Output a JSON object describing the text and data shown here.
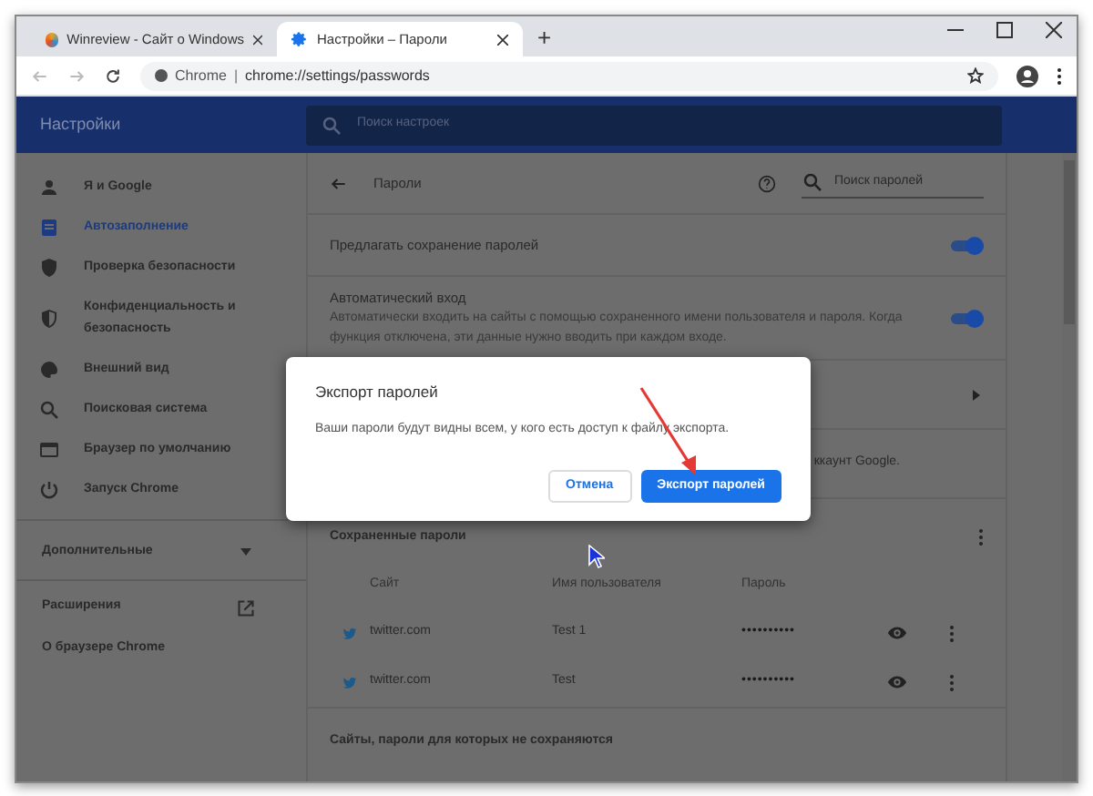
{
  "tabs": [
    {
      "title": "Winreview - Сайт о Windows",
      "kind": "site",
      "selected": false
    },
    {
      "title": "Настройки – Пароли",
      "kind": "settings",
      "selected": true
    }
  ],
  "new_tab": "+",
  "address": {
    "prefix": "Chrome",
    "separator": "|",
    "url": "chrome://settings/passwords"
  },
  "header": {
    "title": "Настройки",
    "search_placeholder": "Поиск настроек"
  },
  "sidebar": {
    "items": [
      {
        "label": "Я и Google",
        "kind": "person",
        "selected": false
      },
      {
        "label": "Автозаполнение",
        "kind": "clipboard",
        "selected": true
      },
      {
        "label": "Проверка безопасности",
        "kind": "shield",
        "selected": false
      },
      {
        "label": "Конфиденциальность и безопасность",
        "kind": "shield-half",
        "selected": false
      },
      {
        "label": "Внешний вид",
        "kind": "palette",
        "selected": false
      },
      {
        "label": "Поисковая система",
        "kind": "search",
        "selected": false
      },
      {
        "label": "Браузер по умолчанию",
        "kind": "browser",
        "selected": false
      },
      {
        "label": "Запуск Chrome",
        "kind": "power",
        "selected": false
      }
    ],
    "advanced": {
      "label": "Дополнительные",
      "expanded": false
    },
    "links": [
      {
        "label": "Расширения",
        "external": true
      },
      {
        "label": "О браузере Chrome",
        "external": false
      }
    ]
  },
  "main": {
    "title": "Пароли",
    "search_placeholder": "Поиск паролей",
    "settings": [
      {
        "title": "Предлагать сохранение паролей",
        "on": true
      },
      {
        "title": "Автоматический вход",
        "description": "Автоматически входить на сайты с помощью сохраненного имени пользователя и пароля. Когда функция отключена, эти данные нужно вводить при каждом входе.",
        "on": true
      }
    ],
    "account_note": "ккаунт Google.",
    "saved_title": "Сохраненные пароли",
    "columns": [
      "Сайт",
      "Имя пользователя",
      "Пароль"
    ],
    "rows": [
      {
        "site": "twitter.com",
        "username": "Test 1",
        "password": "••••••••••"
      },
      {
        "site": "twitter.com",
        "username": "Test",
        "password": "••••••••••"
      }
    ],
    "exceptions_title": "Сайты, пароли для которых не сохраняются"
  },
  "dialog": {
    "title": "Экспорт паролей",
    "message": "Ваши пароли будут видны всем, у кого есть доступ к файлу экспорта.",
    "cancel": "Отмена",
    "confirm": "Экспорт паролей"
  }
}
